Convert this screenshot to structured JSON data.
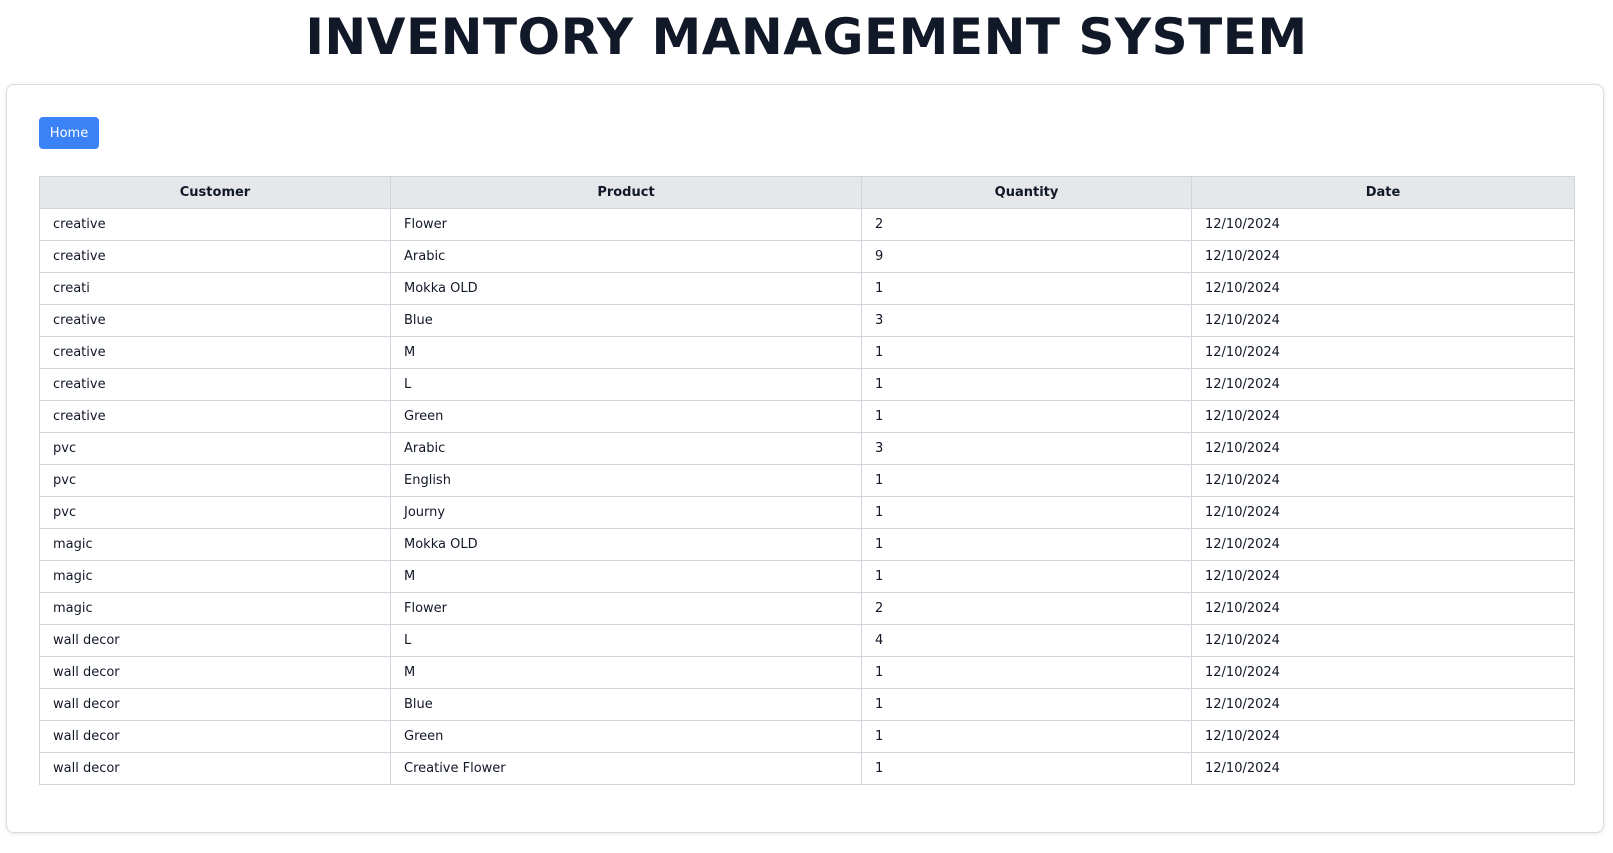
{
  "header": {
    "title": "INVENTORY MANAGEMENT SYSTEM"
  },
  "toolbar": {
    "home_label": "Home"
  },
  "colors": {
    "accent": "#3b82f6",
    "table_header_bg": "#e5e7eb",
    "border": "#d1d5db",
    "text": "#111827"
  },
  "table": {
    "columns": [
      "Customer",
      "Product",
      "Quantity",
      "Date"
    ],
    "rows": [
      [
        "creative",
        "Flower",
        "2",
        "12/10/2024"
      ],
      [
        "creative",
        "Arabic",
        "9",
        "12/10/2024"
      ],
      [
        "creati",
        "Mokka OLD",
        "1",
        "12/10/2024"
      ],
      [
        "creative",
        "Blue",
        "3",
        "12/10/2024"
      ],
      [
        "creative",
        "M",
        "1",
        "12/10/2024"
      ],
      [
        "creative",
        "L",
        "1",
        "12/10/2024"
      ],
      [
        "creative",
        "Green",
        "1",
        "12/10/2024"
      ],
      [
        "pvc",
        "Arabic",
        "3",
        "12/10/2024"
      ],
      [
        "pvc",
        "English",
        "1",
        "12/10/2024"
      ],
      [
        "pvc",
        "Journy",
        "1",
        "12/10/2024"
      ],
      [
        "magic",
        "Mokka OLD",
        "1",
        "12/10/2024"
      ],
      [
        "magic",
        "M",
        "1",
        "12/10/2024"
      ],
      [
        "magic",
        "Flower",
        "2",
        "12/10/2024"
      ],
      [
        "wall decor",
        "L",
        "4",
        "12/10/2024"
      ],
      [
        "wall decor",
        "M",
        "1",
        "12/10/2024"
      ],
      [
        "wall decor",
        "Blue",
        "1",
        "12/10/2024"
      ],
      [
        "wall decor",
        "Green",
        "1",
        "12/10/2024"
      ],
      [
        "wall decor",
        "Creative Flower",
        "1",
        "12/10/2024"
      ]
    ]
  }
}
